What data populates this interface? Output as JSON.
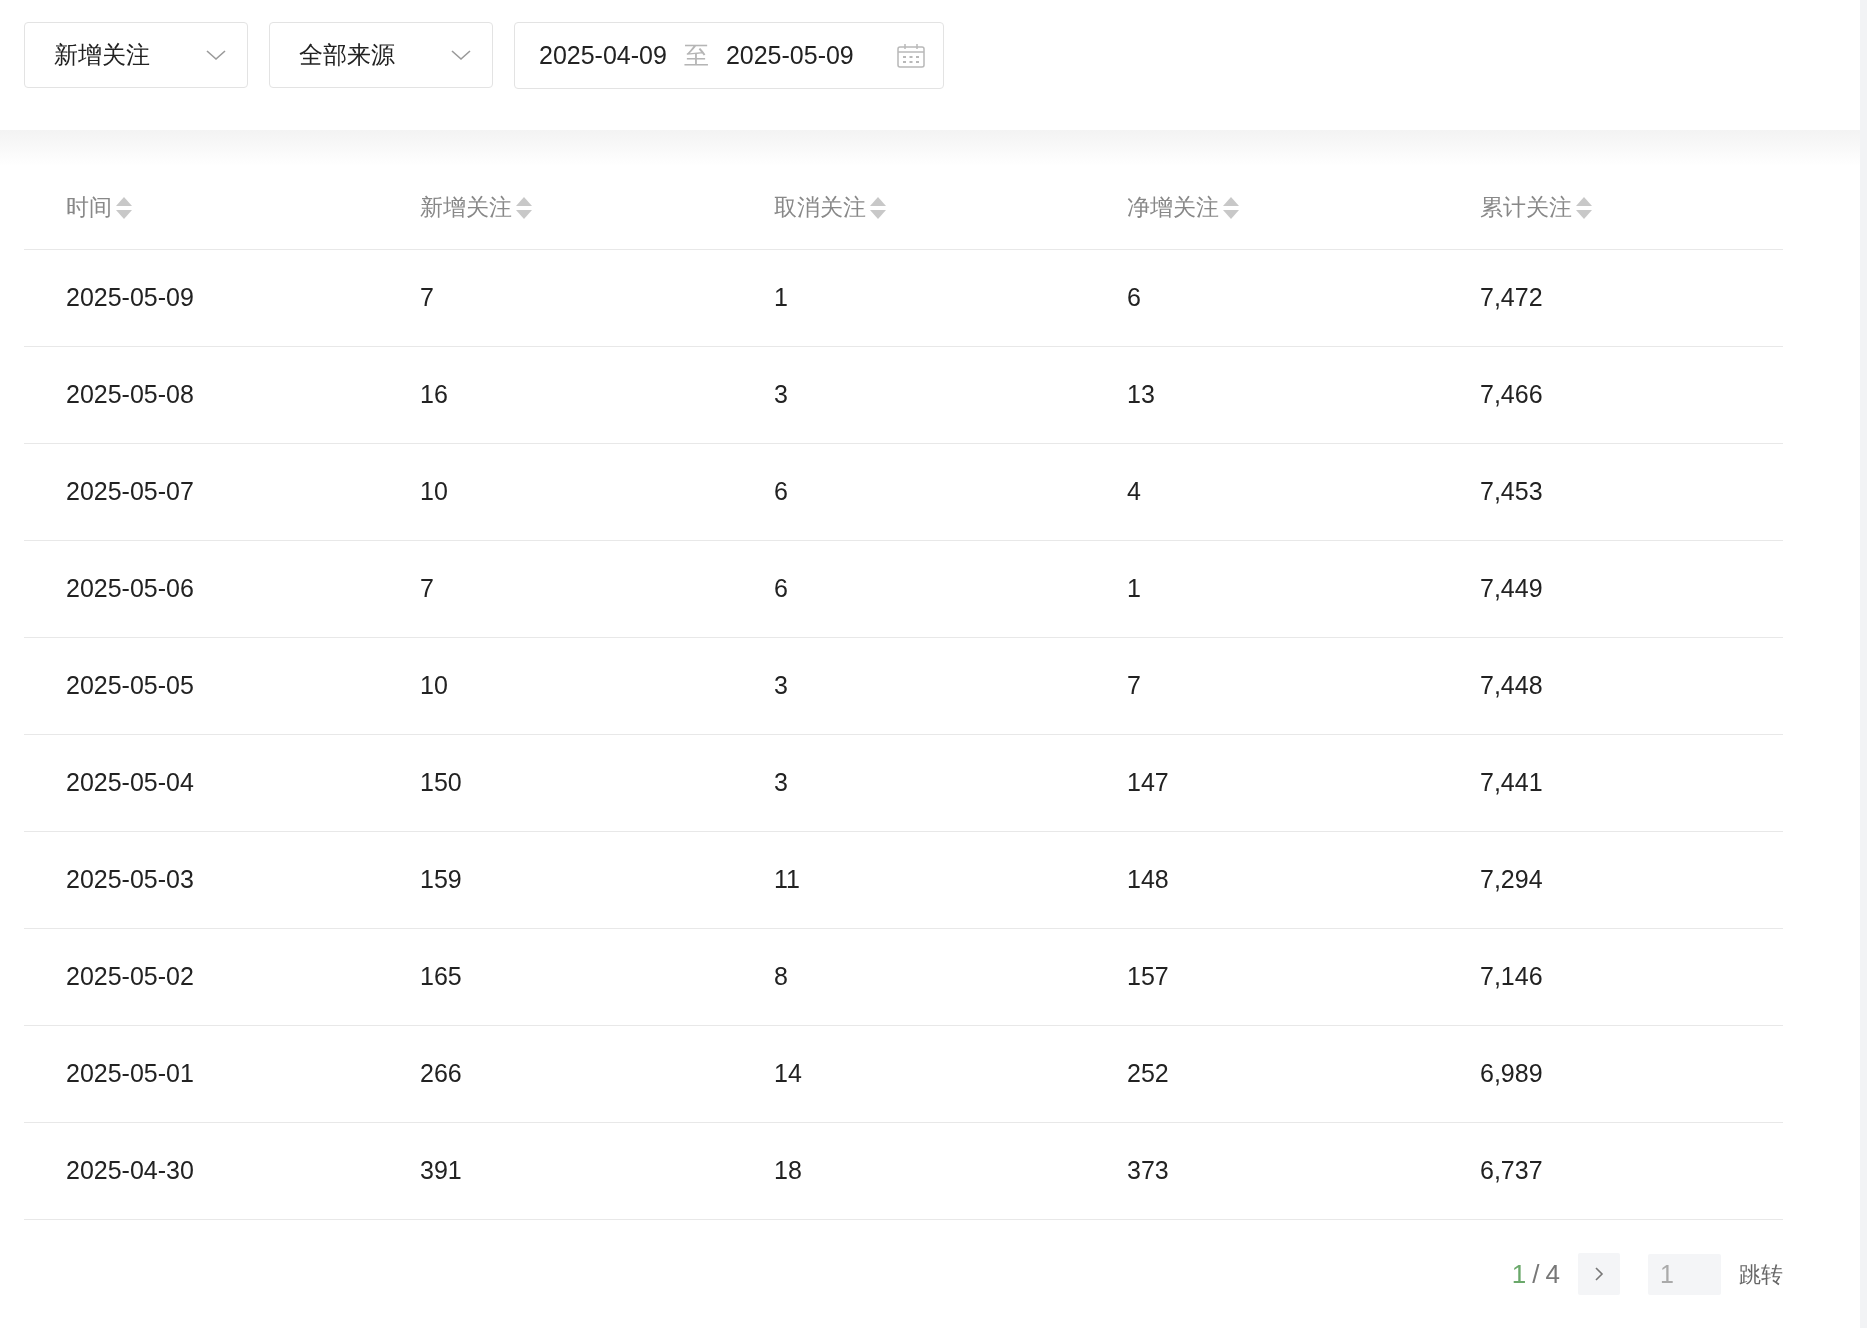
{
  "filters": {
    "metric_select": {
      "value": "新增关注"
    },
    "source_select": {
      "value": "全部来源"
    },
    "date_range": {
      "start": "2025-04-09",
      "separator": "至",
      "end": "2025-05-09"
    }
  },
  "table": {
    "columns": [
      "时间",
      "新增关注",
      "取消关注",
      "净增关注",
      "累计关注"
    ],
    "rows": [
      [
        "2025-05-09",
        "7",
        "1",
        "6",
        "7,472"
      ],
      [
        "2025-05-08",
        "16",
        "3",
        "13",
        "7,466"
      ],
      [
        "2025-05-07",
        "10",
        "6",
        "4",
        "7,453"
      ],
      [
        "2025-05-06",
        "7",
        "6",
        "1",
        "7,449"
      ],
      [
        "2025-05-05",
        "10",
        "3",
        "7",
        "7,448"
      ],
      [
        "2025-05-04",
        "150",
        "3",
        "147",
        "7,441"
      ],
      [
        "2025-05-03",
        "159",
        "11",
        "148",
        "7,294"
      ],
      [
        "2025-05-02",
        "165",
        "8",
        "157",
        "7,146"
      ],
      [
        "2025-05-01",
        "266",
        "14",
        "252",
        "6,989"
      ],
      [
        "2025-04-30",
        "391",
        "18",
        "373",
        "6,737"
      ]
    ]
  },
  "pagination": {
    "current": "1",
    "separator": "/",
    "total": "4",
    "page_input": {
      "placeholder": "1"
    },
    "jump_button": "跳转"
  }
}
